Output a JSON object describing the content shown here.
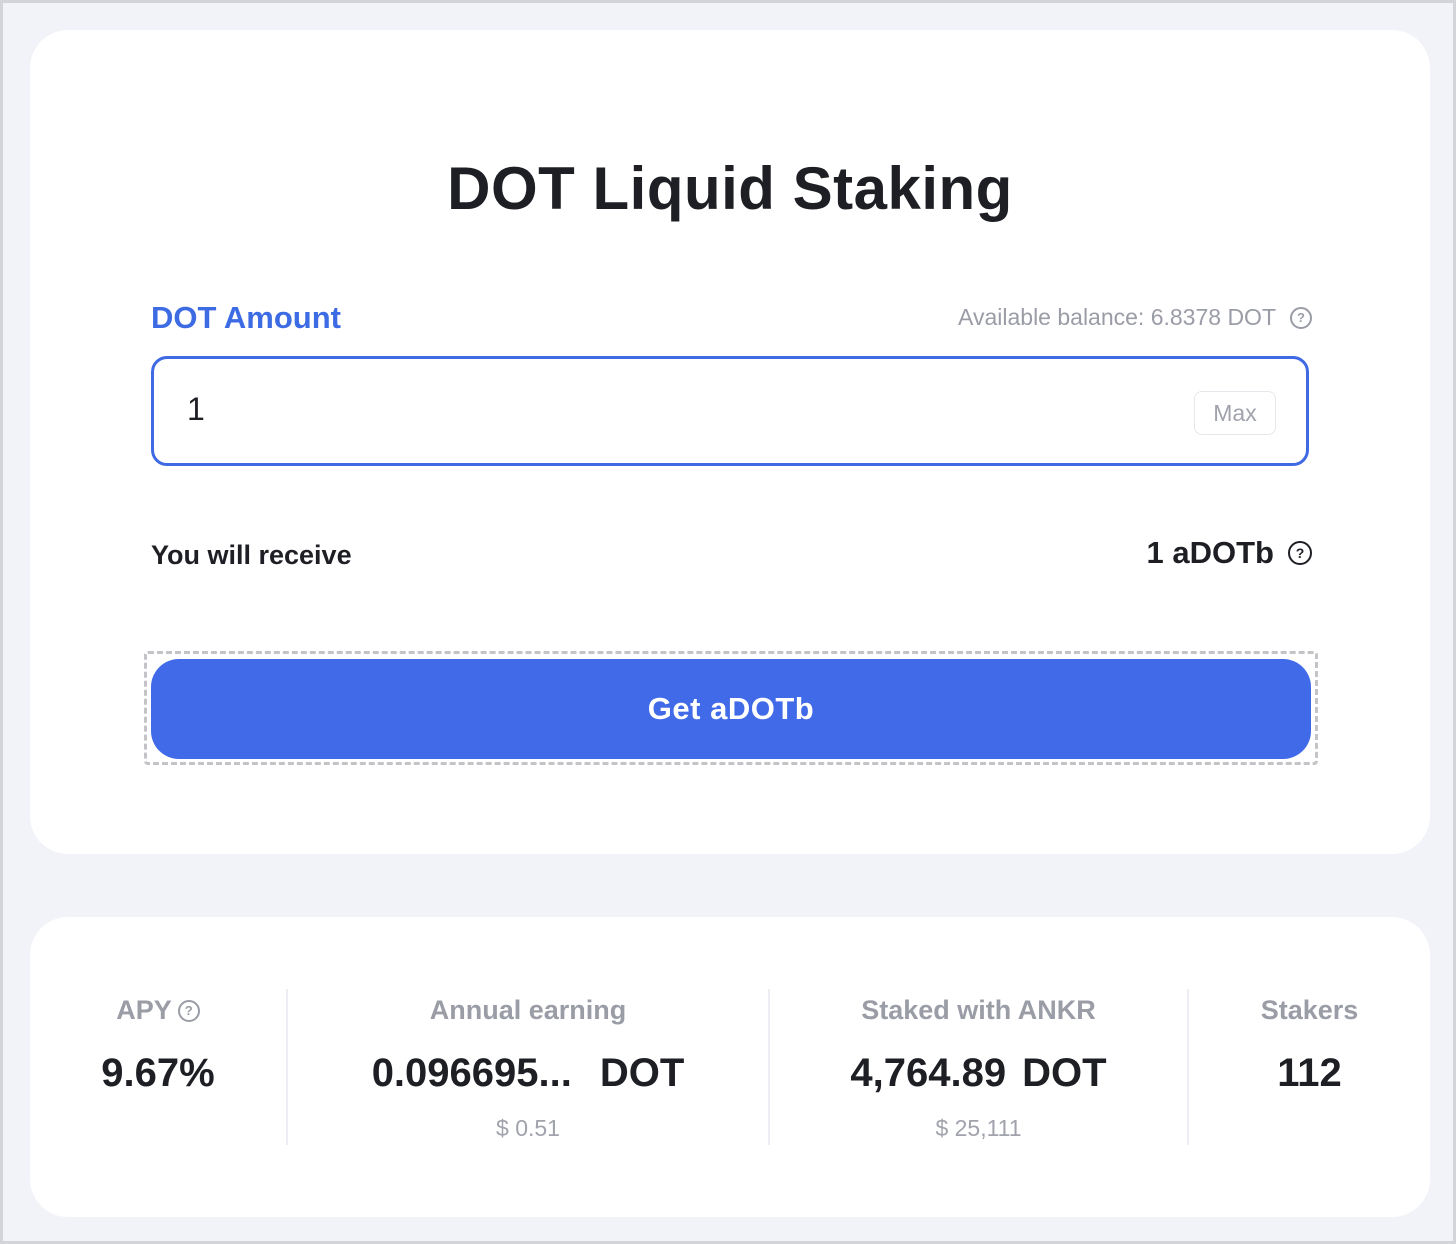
{
  "title": "DOT Liquid Staking",
  "form": {
    "amount_label": "DOT Amount",
    "balance_text": "Available balance: 6.8378 DOT",
    "input_value": "1",
    "max_label": "Max",
    "receive_label": "You will receive",
    "receive_value": "1 aDOTb",
    "submit_label": "Get aDOTb",
    "help_glyph": "?"
  },
  "stats": {
    "apy": {
      "label": "APY",
      "value": "9.67%"
    },
    "annual": {
      "label": "Annual earning",
      "value": "0.096695...",
      "unit": "DOT",
      "usd": "$ 0.51"
    },
    "staked": {
      "label": "Staked with ANKR",
      "value": "4,764.89",
      "unit": "DOT",
      "usd": "$ 25,111"
    },
    "stakers": {
      "label": "Stakers",
      "value": "112"
    }
  },
  "colors": {
    "accent": "#416ae8",
    "label_accent": "#3c6be4",
    "muted": "#9a9ca6",
    "background": "#f2f3f9"
  },
  "icons": [
    "question-circle-icon"
  ]
}
